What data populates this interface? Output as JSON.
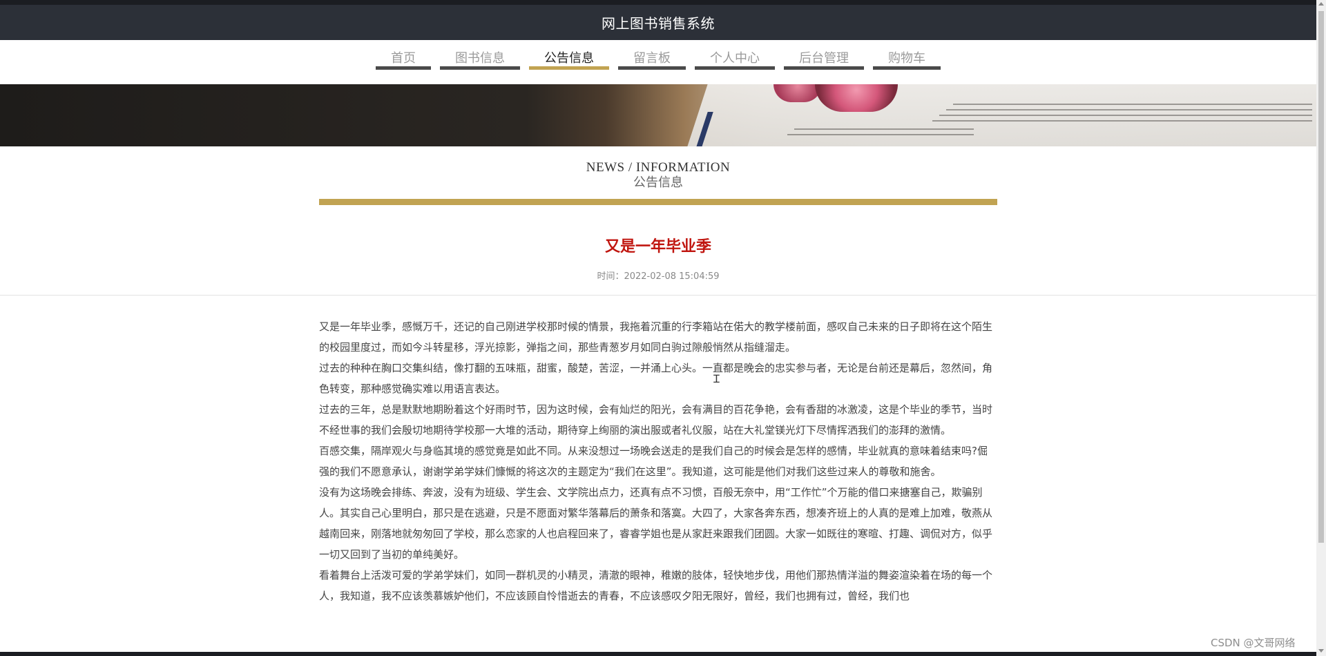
{
  "site": {
    "title": "网上图书销售系统"
  },
  "nav": {
    "items": [
      {
        "label": "首页",
        "active": false
      },
      {
        "label": "图书信息",
        "active": false
      },
      {
        "label": "公告信息",
        "active": true
      },
      {
        "label": "留言板",
        "active": false
      },
      {
        "label": "个人中心",
        "active": false
      },
      {
        "label": "后台管理",
        "active": false
      },
      {
        "label": "购物车",
        "active": false
      }
    ]
  },
  "section": {
    "title_en": "NEWS / INFORMATION",
    "title_cn": "公告信息"
  },
  "article": {
    "title": "又是一年毕业季",
    "time": "时间：2022-02-08 15:04:59",
    "paragraphs": [
      "又是一年毕业季，感慨万千，还记的自己刚进学校那时候的情景，我拖着沉重的行李箱站在偌大的教学楼前面，感叹自己未来的日子即将在这个陌生的校园里度过，而如今斗转星移，浮光掠影，弹指之间，那些青葱岁月如同白驹过隙般悄然从指缝溜走。",
      "过去的种种在胸口交集纠结，像打翻的五味瓶，甜蜜，酸楚，苦涩，一并涌上心头。一直都是晚会的忠实参与者，无论是台前还是幕后，忽然间，角色转变，那种感觉确实难以用语言表达。",
      "过去的三年，总是默默地期盼着这个好雨时节，因为这时候，会有灿烂的阳光，会有满目的百花争艳，会有香甜的冰激凌，这是个毕业的季节，当时不经世事的我们会殷切地期待学校那一大堆的活动，期待穿上绚丽的演出服或者礼仪服，站在大礼堂镁光灯下尽情挥洒我们的澎拜的激情。",
      "百感交集，隔岸观火与身临其境的感觉竟是如此不同。从来没想过一场晚会送走的是我们自己的时候会是怎样的感情，毕业就真的意味着结束吗?倔强的我们不愿意承认，谢谢学弟学妹们慷慨的将这次的主题定为“我们在这里”。我知道，这可能是他们对我们这些过来人的尊敬和施舍。",
      "没有为这场晚会排练、奔波，没有为班级、学生会、文学院出点力，还真有点不习惯，百般无奈中，用“工作忙”个万能的借口来搪塞自己，欺骗别人。其实自己心里明白，那只是在逃避，只是不愿面对繁华落幕后的萧条和落寞。大四了，大家各奔东西，想凑齐班上的人真的是难上加难，敬燕从越南回来，刚落地就匆匆回了学校，那么恋家的人也启程回来了，睿睿学姐也是从家赶来跟我们团圆。大家一如既往的寒暄、打趣、调侃对方，似乎一切又回到了当初的单纯美好。",
      "看着舞台上活泼可爱的学弟学妹们，如同一群机灵的小精灵，清澈的眼神，稚嫩的肢体，轻快地步伐，用他们那热情洋溢的舞姿渲染着在场的每一个人，我知道，我不应该羡慕嫉妒他们，不应该顾自怜惜逝去的青春，不应该感叹夕阳无限好，曾经，我们也拥有过，曾经，我们也"
    ]
  },
  "watermark": "CSDN @文哥网络",
  "icons": {
    "cursor": "text-cursor-icon"
  },
  "colors": {
    "accent_gold": "#c1a352",
    "title_red": "#c0150f",
    "header_bg": "#2c3038"
  }
}
